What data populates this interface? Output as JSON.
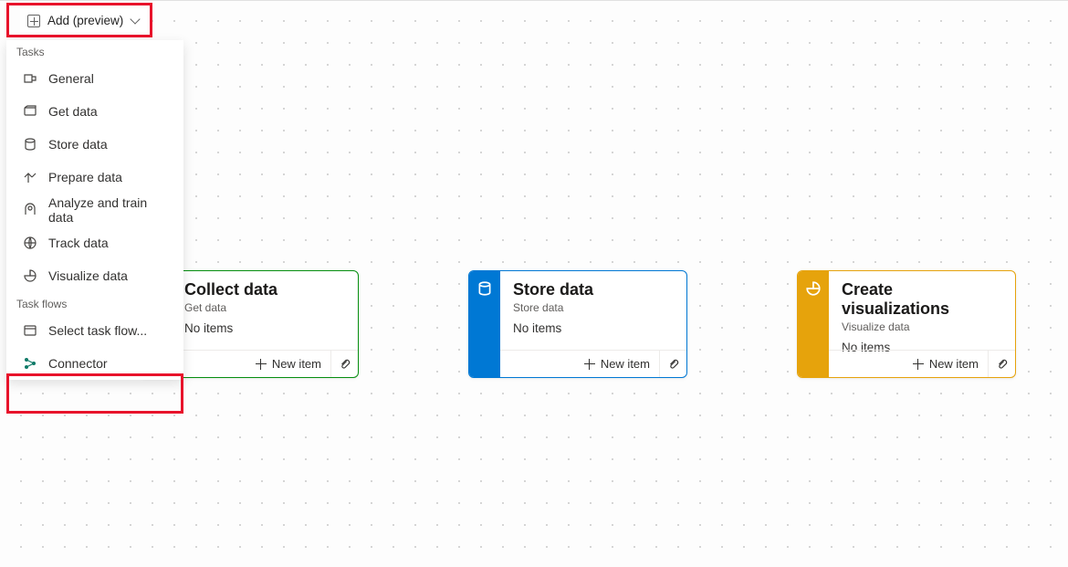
{
  "toolbar": {
    "add_button_label": "Add (preview)"
  },
  "dropdown": {
    "section_tasks": "Tasks",
    "section_taskflows": "Task flows",
    "items_tasks": [
      {
        "label": "General"
      },
      {
        "label": "Get data"
      },
      {
        "label": "Store data"
      },
      {
        "label": "Prepare data"
      },
      {
        "label": "Analyze and train data"
      },
      {
        "label": "Track data"
      },
      {
        "label": "Visualize data"
      }
    ],
    "items_taskflows": [
      {
        "label": "Select task flow..."
      },
      {
        "label": "Connector"
      }
    ]
  },
  "cards": {
    "collect": {
      "title": "Collect data",
      "subtitle": "Get data",
      "items_text": "No items",
      "new_item_label": "New item",
      "accent_color": "#058e0f"
    },
    "store": {
      "title": "Store data",
      "subtitle": "Store data",
      "items_text": "No items",
      "new_item_label": "New item",
      "accent_color": "#0078d4"
    },
    "viz": {
      "title": "Create visualizations",
      "subtitle": "Visualize data",
      "items_text": "No items",
      "new_item_label": "New item",
      "accent_color": "#e6a30c"
    }
  }
}
